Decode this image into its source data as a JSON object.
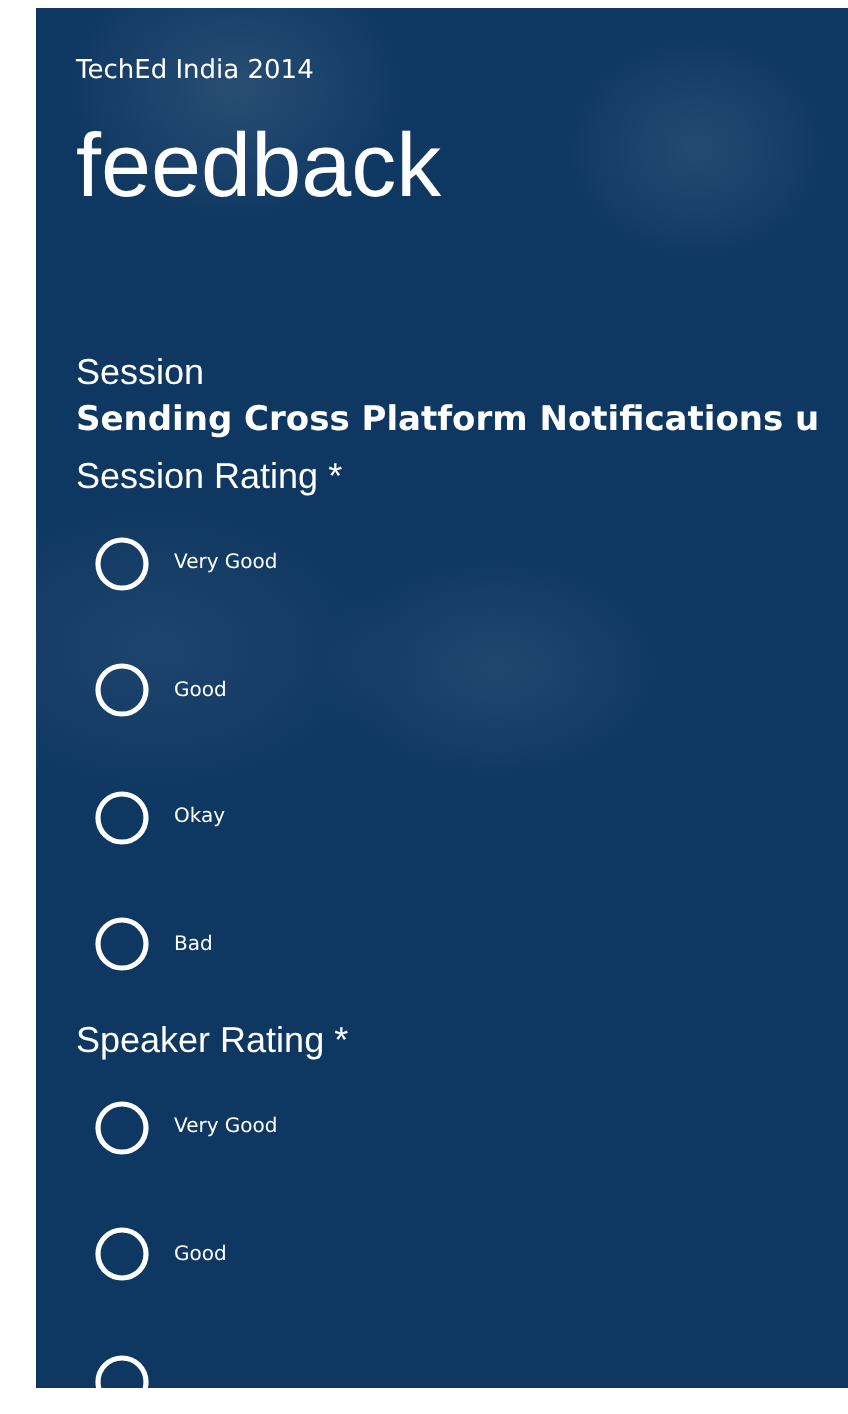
{
  "app_title": "TechEd India 2014",
  "page_title": "feedback",
  "session": {
    "label": "Session",
    "value": "Sending Cross Platform Notifications u"
  },
  "groups": [
    {
      "title": "Session Rating *",
      "options": [
        {
          "label": "Very Good",
          "selected": false
        },
        {
          "label": "Good",
          "selected": false
        },
        {
          "label": "Okay",
          "selected": false
        },
        {
          "label": "Bad",
          "selected": false
        }
      ]
    },
    {
      "title": "Speaker Rating *",
      "options": [
        {
          "label": "Very Good",
          "selected": false
        },
        {
          "label": "Good",
          "selected": false
        },
        {
          "selected": false
        }
      ]
    }
  ]
}
